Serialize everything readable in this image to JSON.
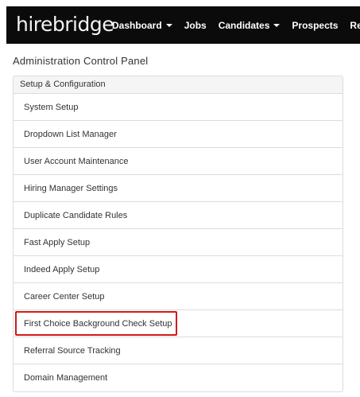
{
  "brand": {
    "name": "hirebridge"
  },
  "nav": {
    "items": [
      {
        "label": "Dashboard",
        "has_caret": true
      },
      {
        "label": "Jobs",
        "has_caret": false
      },
      {
        "label": "Candidates",
        "has_caret": true
      },
      {
        "label": "Prospects",
        "has_caret": false
      },
      {
        "label": "Reports",
        "has_caret": false
      }
    ]
  },
  "page": {
    "title": "Administration Control Panel"
  },
  "panel": {
    "heading": "Setup & Configuration",
    "items": [
      {
        "label": "System Setup"
      },
      {
        "label": "Dropdown List Manager"
      },
      {
        "label": "User Account Maintenance"
      },
      {
        "label": "Hiring Manager Settings"
      },
      {
        "label": "Duplicate Candidate Rules"
      },
      {
        "label": "Fast Apply Setup"
      },
      {
        "label": "Indeed Apply Setup"
      },
      {
        "label": "Career Center Setup"
      },
      {
        "label": "First Choice Background Check Setup",
        "highlighted": true
      },
      {
        "label": "Referral Source Tracking"
      },
      {
        "label": "Domain Management"
      }
    ]
  },
  "colors": {
    "navbar_bg": "#0b0b0b",
    "highlight": "#d11a1a",
    "panel_heading_bg": "#f5f5f5"
  }
}
